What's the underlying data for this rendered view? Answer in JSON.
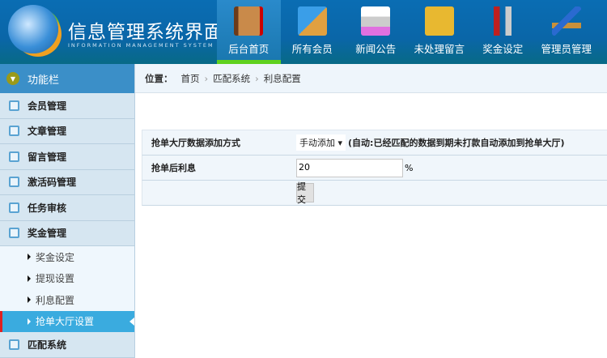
{
  "header": {
    "title": "信息管理系统界面",
    "subtitle": "INFORMATION MANAGEMENT SYSTEM GUI"
  },
  "nav": [
    {
      "label": "后台首页",
      "icon": "book-icon",
      "active": true
    },
    {
      "label": "所有会员",
      "icon": "ruler-triangle-icon"
    },
    {
      "label": "新闻公告",
      "icon": "printer-icon"
    },
    {
      "label": "未处理留言",
      "icon": "folder-download-icon"
    },
    {
      "label": "奖金设定",
      "icon": "tools-icon"
    },
    {
      "label": "管理员管理",
      "icon": "pencil-ruler-icon"
    }
  ],
  "sidebar": {
    "title": "功能栏",
    "items": [
      "会员管理",
      "文章管理",
      "留言管理",
      "激活码管理",
      "任务审核",
      "奖金管理"
    ],
    "sub_items": [
      "奖金设定",
      "提现设置",
      "利息配置",
      "抢单大厅设置"
    ],
    "active_sub": "抢单大厅设置",
    "last_item": "匹配系统"
  },
  "breadcrumb": {
    "label": "位置：",
    "items": [
      "首页",
      "匹配系统",
      "利息配置"
    ]
  },
  "form": {
    "row1": {
      "label": "抢单大厅数据添加方式",
      "select": "手动添加",
      "hint": "(自动:已经匹配的数据到期未打款自动添加到抢单大厅)"
    },
    "row2": {
      "label": "抢单后利息",
      "value": "20",
      "unit": "%"
    },
    "submit": "提交"
  },
  "colors": {
    "header": "#0a6db3",
    "active_nav_bar": "#5fd11e",
    "active_sub": "#3aabdf",
    "sidebar": "#d6e6f1"
  }
}
